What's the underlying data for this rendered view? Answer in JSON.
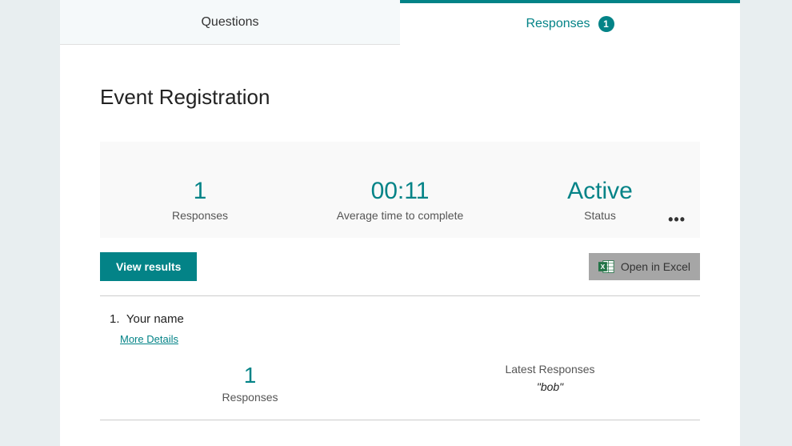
{
  "tabs": {
    "questions": "Questions",
    "responses": "Responses",
    "responses_count": "1"
  },
  "title": "Event Registration",
  "summary": {
    "responses": {
      "value": "1",
      "label": "Responses"
    },
    "avgtime": {
      "value": "00:11",
      "label": "Average time to complete"
    },
    "status": {
      "value": "Active",
      "label": "Status"
    }
  },
  "actions": {
    "view_results": "View results",
    "open_excel": "Open in Excel"
  },
  "questions": [
    {
      "number": "1",
      "text": "Your name",
      "more_details": "More Details",
      "responses": {
        "value": "1",
        "label": "Responses"
      },
      "latest": {
        "label": "Latest Responses",
        "value": "\"bob\""
      }
    }
  ]
}
